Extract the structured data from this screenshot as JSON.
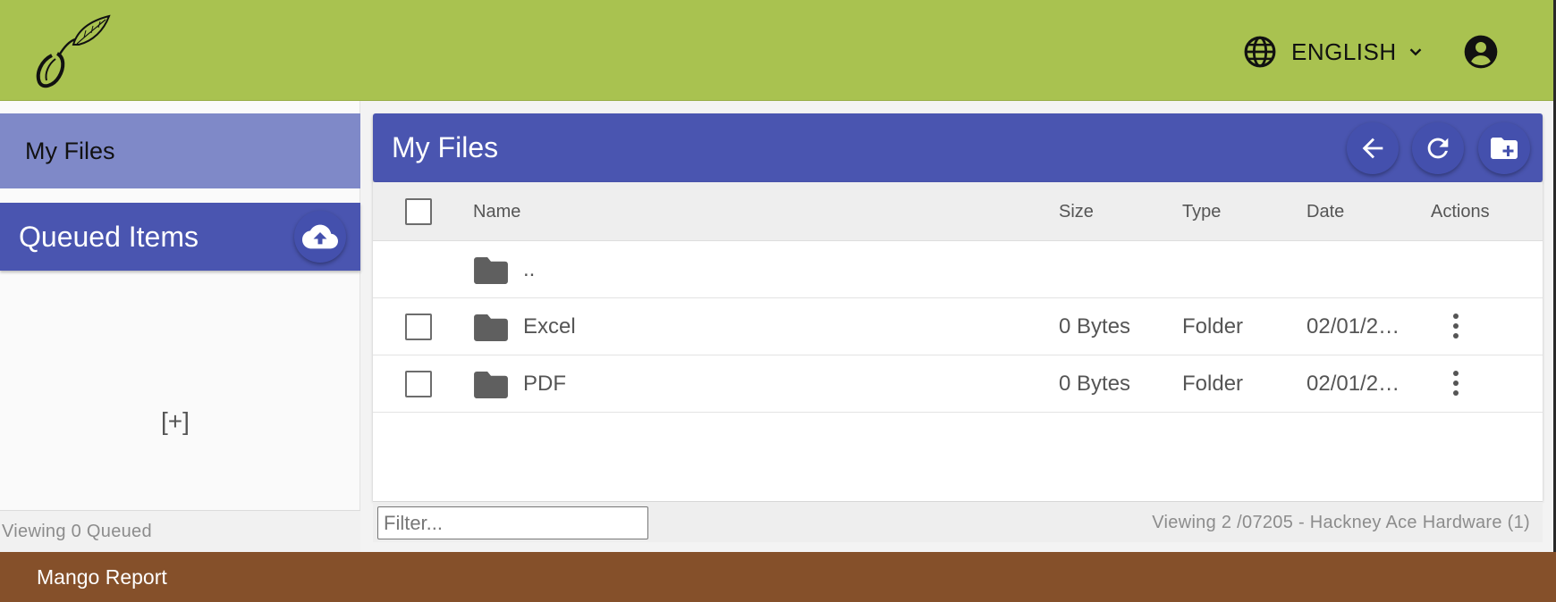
{
  "header": {
    "language": "ENGLISH",
    "brand_color": "#a9c250"
  },
  "sidebar": {
    "my_files_label": "My Files",
    "queued_title": "Queued Items",
    "add_label": "[+]",
    "queued_status": "Viewing 0 Queued"
  },
  "panel": {
    "title": "My Files",
    "accent_color": "#4a55b0",
    "actions": [
      "arrow-back-icon",
      "refresh-icon",
      "create-new-folder-icon"
    ]
  },
  "table": {
    "columns": [
      "Name",
      "Size",
      "Type",
      "Date",
      "Actions"
    ],
    "parent_name": "..",
    "rows": [
      {
        "name": "Excel",
        "size": "0 Bytes",
        "type": "Folder",
        "date": "02/01/2…"
      },
      {
        "name": "PDF",
        "size": "0 Bytes",
        "type": "Folder",
        "date": "02/01/2…"
      }
    ]
  },
  "footer_bar": {
    "filter_placeholder": "Filter...",
    "viewing": "Viewing 2 /07205 - Hackney Ace Hardware (1)"
  },
  "page_footer": {
    "label": "Mango Report",
    "color": "#85502a"
  }
}
